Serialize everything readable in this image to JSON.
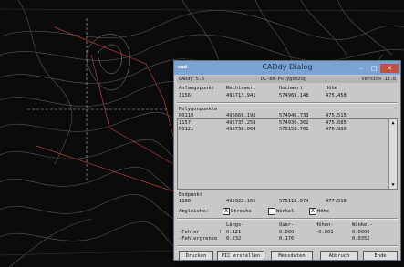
{
  "window": {
    "app_icon_text": "cad",
    "title": "CADdy Dialog"
  },
  "header": {
    "left": "CADdy 5.5",
    "center": "DL-BR-Polygonzug",
    "right": "Version 13.8"
  },
  "columns": {
    "c0": "Anfangspunkt",
    "c1": "Rechtswert",
    "c2": "Hochwert",
    "c3": "Höhe"
  },
  "start_point": {
    "id": "1156",
    "rechts": "495713.941",
    "hoch": "574969.148",
    "hoehe": "475.458"
  },
  "polygon_label": "Polygonpunkte",
  "polygon_points": [
    {
      "id": "P0110",
      "rechts": "495666.198",
      "hoch": "574946.733",
      "hoehe": "475.515"
    },
    {
      "id": "1157",
      "rechts": "495735.259",
      "hoch": "574936.302",
      "hoehe": "475.685"
    },
    {
      "id": "P0121",
      "rechts": "495738.064",
      "hoch": "575158.701",
      "hoehe": "476.980"
    }
  ],
  "end_label": "Endpunkt",
  "end_point": {
    "id": "1180",
    "rechts": "495922.165",
    "hoch": "575118.074",
    "hoehe": "477.518"
  },
  "abgleich": {
    "label": "Abgleiche:",
    "strecke": "Strecke",
    "winkel": "Winkel",
    "hoehe": "Höhe",
    "strecke_checked": true,
    "winkel_checked": false,
    "hoehe_checked": true
  },
  "errors": {
    "h_laengs": "Längs-",
    "h_quer": "Quer-",
    "h_hoehen": "Höhen-",
    "h_winkel": "Winkel-",
    "row1_label": "-Fehler",
    "row1_mark": "!",
    "row1": [
      "0.121",
      "0.000",
      "-0.001",
      "0.0000"
    ],
    "row2_label": "-Fehlergrenze",
    "row2": [
      "0.232",
      "0.176",
      "",
      "0.0352"
    ]
  },
  "buttons": {
    "drucken": "Drucken",
    "pic": "PIC erstellen",
    "messdaten": "Messdaten",
    "abbruch": "Abbruch",
    "ende": "Ende"
  },
  "scroll": {
    "up": "▲",
    "down": "▼"
  },
  "check_mark": "X",
  "titlebar": {
    "min": "–",
    "max": "□",
    "close": "✕"
  }
}
